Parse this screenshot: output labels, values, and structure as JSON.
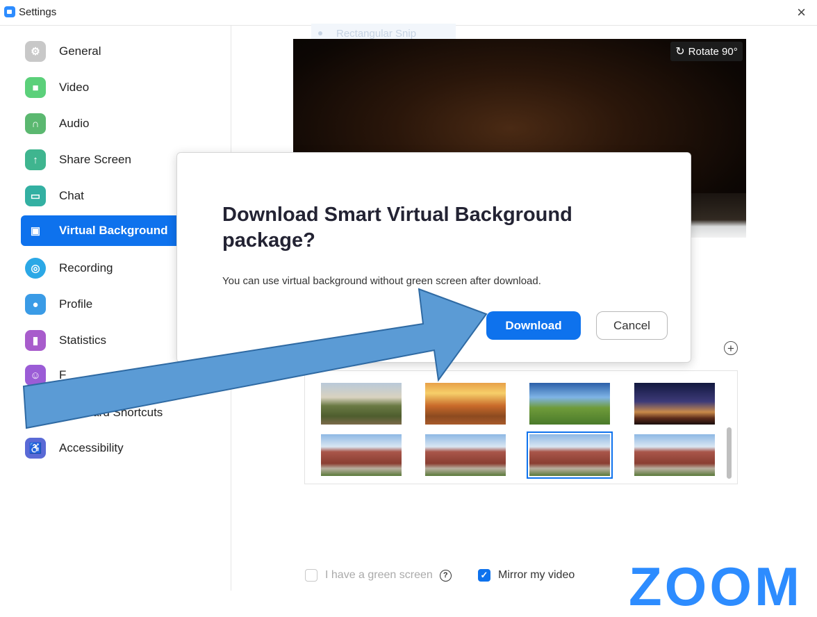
{
  "window": {
    "title": "Settings",
    "close_icon": "×"
  },
  "sidebar": {
    "items": [
      {
        "label": "General",
        "icon": "gear-icon",
        "color": "#c8c8c8"
      },
      {
        "label": "Video",
        "icon": "video-camera-icon",
        "color": "#5bd07a"
      },
      {
        "label": "Audio",
        "icon": "headphones-icon",
        "color": "#5bb870"
      },
      {
        "label": "Share Screen",
        "icon": "share-screen-icon",
        "color": "#3fb58f"
      },
      {
        "label": "Chat",
        "icon": "chat-bubble-icon",
        "color": "#33b0a2"
      },
      {
        "label": "Virtual Background",
        "icon": "virtual-background-icon",
        "color": "#0e72ed"
      },
      {
        "label": "Recording",
        "icon": "recording-icon",
        "color": "#2ba8e6"
      },
      {
        "label": "Profile",
        "icon": "profile-icon",
        "color": "#3a9be6"
      },
      {
        "label": "Statistics",
        "icon": "statistics-icon",
        "color": "#a85ccc"
      },
      {
        "label": "F",
        "icon": "feedback-icon",
        "color": "#9b5cd6"
      },
      {
        "label": "Keyboard Shortcuts",
        "icon": "keyboard-icon",
        "color": "#7a6fd6"
      },
      {
        "label": "Accessibility",
        "icon": "accessibility-icon",
        "color": "#5a6ad6"
      }
    ]
  },
  "preview": {
    "ghost_text": "Rectangular Snip",
    "rotate_label": "Rotate 90°"
  },
  "gallery": {
    "add_label": "+",
    "selected_index": 6
  },
  "dialog": {
    "title": "Download Smart Virtual Background package?",
    "message": "You can use virtual background without green screen after download.",
    "download_label": "Download",
    "cancel_label": "Cancel"
  },
  "options": {
    "green_screen_label": "I have a green screen",
    "green_screen_checked": false,
    "mirror_label": "Mirror my video",
    "mirror_checked": true
  },
  "brand": {
    "logo_text": "zoom",
    "accent": "#0e72ed"
  }
}
